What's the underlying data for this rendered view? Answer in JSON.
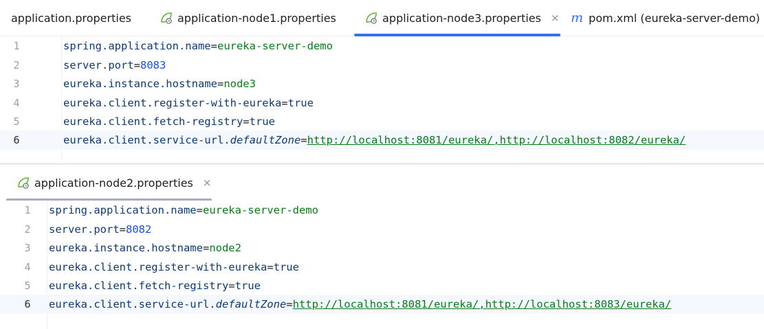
{
  "top_tabs": [
    {
      "label": "application.properties",
      "icon": "none",
      "active": false
    },
    {
      "label": "application-node1.properties",
      "icon": "spring-leaf-icon",
      "active": false
    },
    {
      "label": "application-node3.properties",
      "icon": "spring-leaf-icon",
      "active": true,
      "close": "×"
    },
    {
      "label": "pom.xml (eureka-server-demo)",
      "icon": "maven-icon",
      "icon_glyph": "m",
      "active": false
    }
  ],
  "bottom_tab": {
    "label": "application-node2.properties",
    "icon": "spring-leaf-icon",
    "close": "×"
  },
  "colors": {
    "active_tab_underline": "#3574f0",
    "inactive_tab_underline": "#a8adb7",
    "key": "#0d3a78",
    "string_value": "#067d17",
    "number_value": "#1750eb"
  },
  "editor_top": {
    "lines": [
      {
        "num": "1",
        "key": "spring.application.name",
        "eq": "=",
        "value": "eureka-server-demo"
      },
      {
        "num": "2",
        "key": "server.port",
        "eq": "=",
        "value": "8083"
      },
      {
        "num": "3",
        "key": "eureka.instance.hostname",
        "eq": "=",
        "value": "node3"
      },
      {
        "num": "4",
        "key": "eureka.client.register-with-eureka",
        "eq": "=",
        "value": "true"
      },
      {
        "num": "5",
        "key": "eureka.client.fetch-registry",
        "eq": "=",
        "value": "true"
      },
      {
        "num": "6",
        "key": "eureka.client.service-url.",
        "key_italic": "defaultZone",
        "eq": "=",
        "value": "http://localhost:8081/eureka/,http://localhost:8082/eureka/"
      }
    ]
  },
  "editor_bottom": {
    "lines": [
      {
        "num": "1",
        "key": "spring.application.name",
        "eq": "=",
        "value": "eureka-server-demo"
      },
      {
        "num": "2",
        "key": "server.port",
        "eq": "=",
        "value": "8082"
      },
      {
        "num": "3",
        "key": "eureka.instance.hostname",
        "eq": "=",
        "value": "node2"
      },
      {
        "num": "4",
        "key": "eureka.client.register-with-eureka",
        "eq": "=",
        "value": "true"
      },
      {
        "num": "5",
        "key": "eureka.client.fetch-registry",
        "eq": "=",
        "value": "true"
      },
      {
        "num": "6",
        "key": "eureka.client.service-url.",
        "key_italic": "defaultZone",
        "eq": "=",
        "value": "http://localhost:8081/eureka/,http://localhost:8083/eureka/"
      }
    ]
  }
}
